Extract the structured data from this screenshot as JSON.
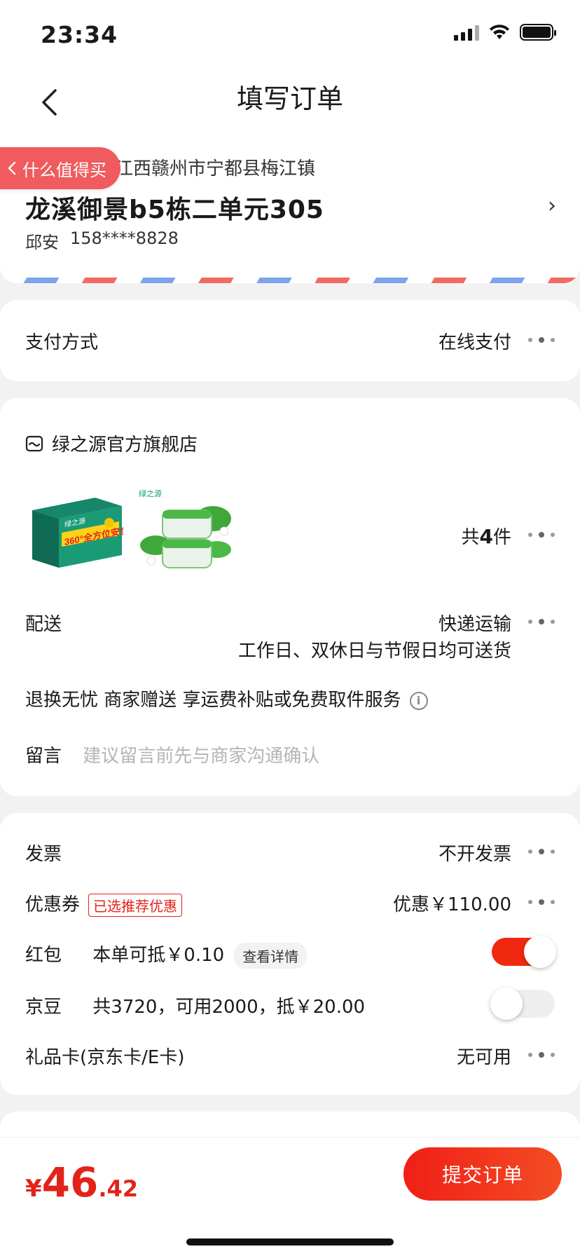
{
  "status": {
    "time": "23:34"
  },
  "nav": {
    "title": "填写订单"
  },
  "smzdm": {
    "label": "什么值得买"
  },
  "address": {
    "region": "江西赣州市宁都县梅江镇",
    "detail": "龙溪御景b5栋二单元305",
    "name": "邱安",
    "phone": "158****8828"
  },
  "payment": {
    "label": "支付方式",
    "value": "在线支付"
  },
  "store": {
    "name": "绿之源官方旗舰店",
    "count_prefix": "共",
    "count": "4",
    "count_suffix": "件",
    "products": [
      {
        "brand": "绿之源",
        "badge": "360°全方位安全卫士"
      },
      {
        "brand": "绿之源"
      }
    ],
    "delivery_label": "配送",
    "delivery_method": "快递运输",
    "delivery_note": "工作日、双休日与节假日均可送货",
    "service": "退换无忧 商家赠送 享运费补贴或免费取件服务",
    "message_label": "留言",
    "message_placeholder": "建议留言前先与商家沟通确认"
  },
  "invoice": {
    "label": "发票",
    "value": "不开发票"
  },
  "coupon": {
    "label": "优惠券",
    "tag": "已选推荐优惠",
    "value": "优惠￥110.00"
  },
  "redpacket": {
    "label": "红包",
    "desc": "本单可抵￥0.10",
    "detail": "查看详情",
    "enabled": true
  },
  "jingdou": {
    "label": "京豆",
    "desc": "共3720，可用2000，抵￥20.00",
    "enabled": false
  },
  "giftcard": {
    "label": "礼品卡(京东卡/E卡)",
    "value": "无可用"
  },
  "total": {
    "currency": "¥",
    "integer": "46",
    "decimal": ".42"
  },
  "submit": {
    "label": "提交订单"
  },
  "colors": {
    "accent": "#e2231a",
    "toggle_on": "#f0280f"
  }
}
